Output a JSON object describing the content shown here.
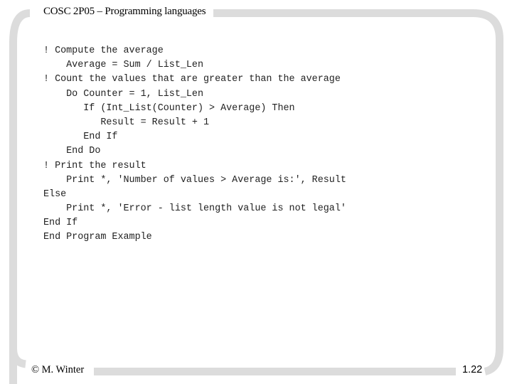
{
  "slide": {
    "title": "COSC 2P05 – Programming languages",
    "footer_author": "© M. Winter",
    "page_number": "1.22",
    "frame_color": "#dcdcdc"
  },
  "code_lines": [
    "! Compute the average",
    "    Average = Sum / List_Len",
    "! Count the values that are greater than the average",
    "    Do Counter = 1, List_Len",
    "       If (Int_List(Counter) > Average) Then",
    "          Result = Result + 1",
    "       End If",
    "    End Do",
    "! Print the result",
    "    Print *, 'Number of values > Average is:', Result",
    "Else",
    "    Print *, 'Error - list length value is not legal'",
    "End If",
    "End Program Example"
  ]
}
